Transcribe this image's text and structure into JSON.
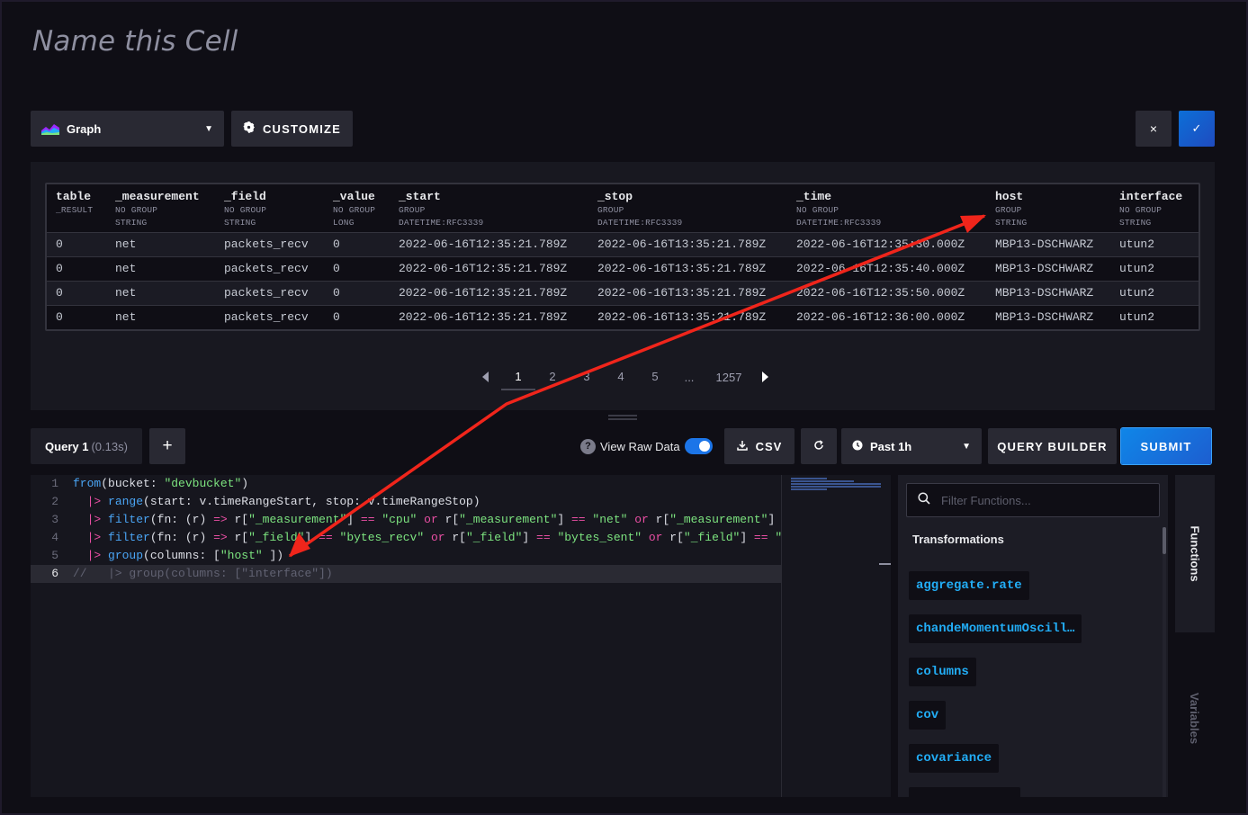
{
  "cell": {
    "title": "Name this Cell"
  },
  "toolbar": {
    "visualization": "Graph",
    "customize": "CUSTOMIZE",
    "close_symbol": "×",
    "confirm_symbol": "✓"
  },
  "table": {
    "columns": [
      {
        "name": "table",
        "group": "_RESULT",
        "type": ""
      },
      {
        "name": "_measurement",
        "group": "NO GROUP",
        "type": "STRING"
      },
      {
        "name": "_field",
        "group": "NO GROUP",
        "type": "STRING"
      },
      {
        "name": "_value",
        "group": "NO GROUP",
        "type": "LONG"
      },
      {
        "name": "_start",
        "group": "GROUP",
        "type": "DATETIME:RFC3339"
      },
      {
        "name": "_stop",
        "group": "GROUP",
        "type": "DATETIME:RFC3339"
      },
      {
        "name": "_time",
        "group": "NO GROUP",
        "type": "DATETIME:RFC3339"
      },
      {
        "name": "host",
        "group": "GROUP",
        "type": "STRING"
      },
      {
        "name": "interface",
        "group": "NO GROUP",
        "type": "STRING"
      }
    ],
    "rows": [
      [
        "0",
        "net",
        "packets_recv",
        "0",
        "2022-06-16T12:35:21.789Z",
        "2022-06-16T13:35:21.789Z",
        "2022-06-16T12:35:30.000Z",
        "MBP13-DSCHWARZ",
        "utun2"
      ],
      [
        "0",
        "net",
        "packets_recv",
        "0",
        "2022-06-16T12:35:21.789Z",
        "2022-06-16T13:35:21.789Z",
        "2022-06-16T12:35:40.000Z",
        "MBP13-DSCHWARZ",
        "utun2"
      ],
      [
        "0",
        "net",
        "packets_recv",
        "0",
        "2022-06-16T12:35:21.789Z",
        "2022-06-16T13:35:21.789Z",
        "2022-06-16T12:35:50.000Z",
        "MBP13-DSCHWARZ",
        "utun2"
      ],
      [
        "0",
        "net",
        "packets_recv",
        "0",
        "2022-06-16T12:35:21.789Z",
        "2022-06-16T13:35:21.789Z",
        "2022-06-16T12:36:00.000Z",
        "MBP13-DSCHWARZ",
        "utun2"
      ]
    ]
  },
  "pagination": {
    "pages": [
      "1",
      "2",
      "3",
      "4",
      "5"
    ],
    "ellipsis": "...",
    "last": "1257",
    "current": "1"
  },
  "query": {
    "tab_label": "Query 1",
    "tab_time": "(0.13s)",
    "add_symbol": "+",
    "view_raw_label": "View Raw Data",
    "view_raw_enabled": true,
    "csv_label": "CSV",
    "time_range": "Past 1h",
    "query_builder_label": "QUERY BUILDER",
    "submit_label": "SUBMIT"
  },
  "editor": {
    "line_numbers": [
      "1",
      "2",
      "3",
      "4",
      "5",
      "6"
    ],
    "lines": [
      [
        [
          "kw",
          "from"
        ],
        [
          "plain",
          "(bucket: "
        ],
        [
          "str",
          "\"devbucket\""
        ],
        [
          "plain",
          ")"
        ]
      ],
      [
        [
          "plain",
          "  "
        ],
        [
          "op",
          "|>"
        ],
        [
          "plain",
          " "
        ],
        [
          "kw",
          "range"
        ],
        [
          "plain",
          "(start: v.timeRangeStart, stop: v.timeRangeStop)"
        ]
      ],
      [
        [
          "plain",
          "  "
        ],
        [
          "op",
          "|>"
        ],
        [
          "plain",
          " "
        ],
        [
          "kw",
          "filter"
        ],
        [
          "plain",
          "(fn: (r) "
        ],
        [
          "op",
          "=>"
        ],
        [
          "plain",
          " r["
        ],
        [
          "str",
          "\"_measurement\""
        ],
        [
          "plain",
          "] "
        ],
        [
          "op",
          "=="
        ],
        [
          "plain",
          " "
        ],
        [
          "str",
          "\"cpu\""
        ],
        [
          "plain",
          " "
        ],
        [
          "op",
          "or"
        ],
        [
          "plain",
          " r["
        ],
        [
          "str",
          "\"_measurement\""
        ],
        [
          "plain",
          "] "
        ],
        [
          "op",
          "=="
        ],
        [
          "plain",
          " "
        ],
        [
          "str",
          "\"net\""
        ],
        [
          "plain",
          " "
        ],
        [
          "op",
          "or"
        ],
        [
          "plain",
          " r["
        ],
        [
          "str",
          "\"_measurement\""
        ],
        [
          "plain",
          "] "
        ]
      ],
      [
        [
          "plain",
          "  "
        ],
        [
          "op",
          "|>"
        ],
        [
          "plain",
          " "
        ],
        [
          "kw",
          "filter"
        ],
        [
          "plain",
          "(fn: (r) "
        ],
        [
          "op",
          "=>"
        ],
        [
          "plain",
          " r["
        ],
        [
          "str",
          "\"_field\""
        ],
        [
          "plain",
          "] "
        ],
        [
          "op",
          "=="
        ],
        [
          "plain",
          " "
        ],
        [
          "str",
          "\"bytes_recv\""
        ],
        [
          "plain",
          " "
        ],
        [
          "op",
          "or"
        ],
        [
          "plain",
          " r["
        ],
        [
          "str",
          "\"_field\""
        ],
        [
          "plain",
          "] "
        ],
        [
          "op",
          "=="
        ],
        [
          "plain",
          " "
        ],
        [
          "str",
          "\"bytes_sent\""
        ],
        [
          "plain",
          " "
        ],
        [
          "op",
          "or"
        ],
        [
          "plain",
          " r["
        ],
        [
          "str",
          "\"_field\""
        ],
        [
          "plain",
          "] "
        ],
        [
          "op",
          "=="
        ],
        [
          "plain",
          " "
        ],
        [
          "str",
          "\""
        ]
      ],
      [
        [
          "plain",
          "  "
        ],
        [
          "op",
          "|>"
        ],
        [
          "plain",
          " "
        ],
        [
          "kw",
          "group"
        ],
        [
          "plain",
          "(columns: ["
        ],
        [
          "str",
          "\"host\""
        ],
        [
          "plain",
          " ])"
        ]
      ],
      [
        [
          "cm",
          "//   |> group(columns: [\"interface\"])"
        ]
      ]
    ]
  },
  "functions": {
    "tab_label": "Functions",
    "variables_label": "Variables",
    "search_placeholder": "Filter Functions...",
    "heading": "Transformations",
    "items": [
      "aggregate.rate",
      "chandeMomentumOscill…",
      "columns",
      "cov",
      "covariance"
    ]
  },
  "colors": {
    "background": "#0f0e15",
    "panel": "#181820",
    "accent": "#1c75e8",
    "annotation_arrow": "#f0251b",
    "function_text": "#22adf6"
  }
}
